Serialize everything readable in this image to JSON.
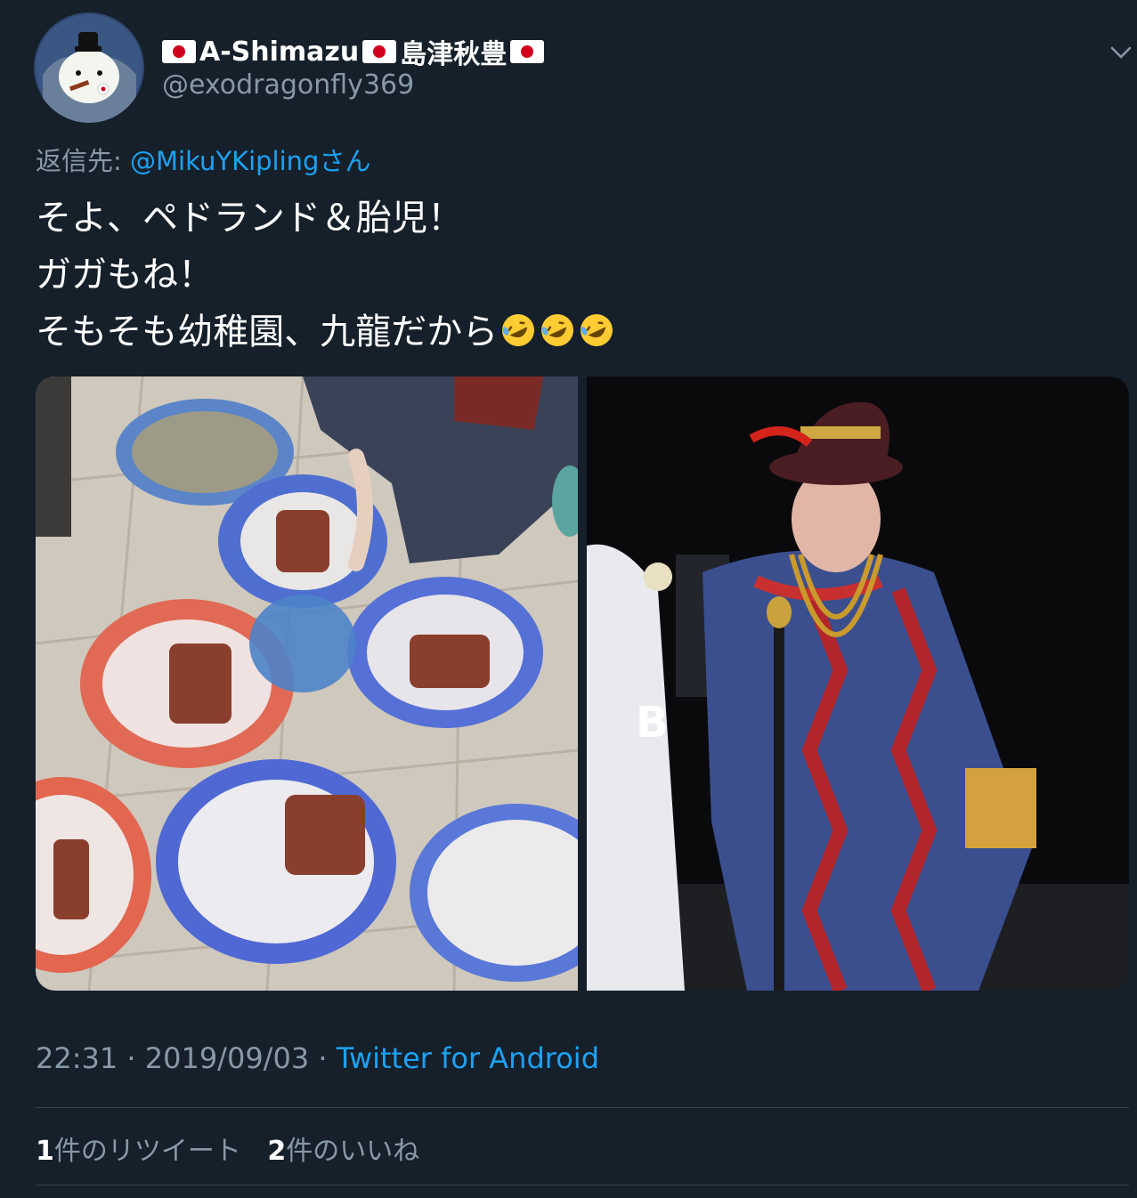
{
  "author": {
    "display_name_prefix": "A-Shimazu",
    "display_name_suffix": "島津秋豊",
    "handle": "@exodragonfly369",
    "avatar_icon": "avatar-icon"
  },
  "reply": {
    "label": "返信先: ",
    "mention": "@MikuYKipling",
    "suffix": "さん"
  },
  "tweet": {
    "line1": "そよ、ペドランド＆胎児！",
    "line2": "ガガもね！",
    "line3": "そもそも幼稚園、九龍だから"
  },
  "meta": {
    "time": "22:31",
    "sep1": " · ",
    "date": "2019/09/03",
    "sep2": " · ",
    "source": "Twitter for Android"
  },
  "stats": {
    "retweet_count": "1",
    "retweet_label": "件のリツイート",
    "like_count": "2",
    "like_label": "件のいいね"
  },
  "media": {
    "watermark": "B"
  },
  "colors": {
    "background": "#15202b",
    "secondary_text": "#8899a6",
    "link": "#1da1f2",
    "divider": "#38444d"
  }
}
